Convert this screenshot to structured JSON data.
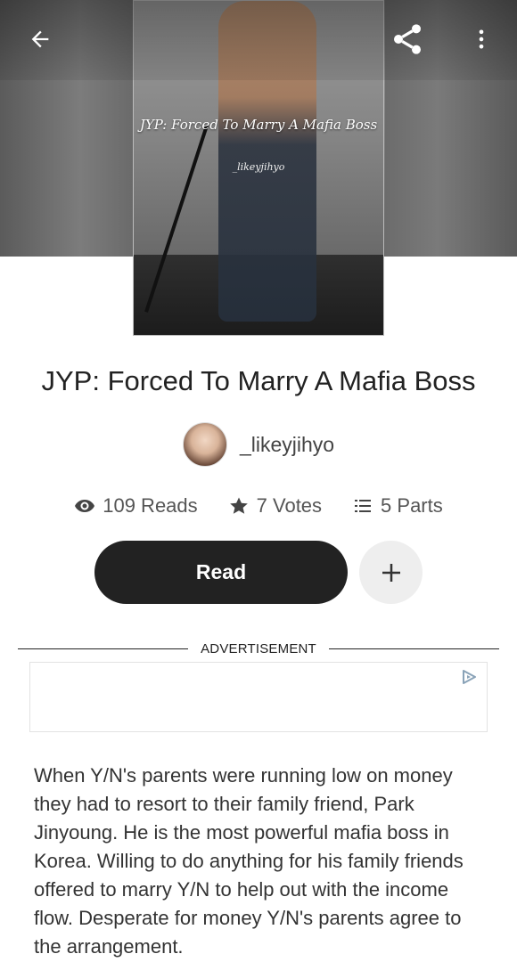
{
  "header": {
    "back_icon": "arrow-left-icon",
    "share_icon": "share-icon",
    "more_icon": "more-vertical-icon"
  },
  "cover": {
    "title": "JYP: Forced To Marry A Mafia Boss",
    "author_signature": "_likeyjihyo"
  },
  "story": {
    "title": "JYP: Forced To Marry A Mafia Boss",
    "author": "_likeyjihyo"
  },
  "stats": {
    "reads": "109 Reads",
    "votes": "7 Votes",
    "parts": "5 Parts"
  },
  "actions": {
    "read_label": "Read",
    "add_icon": "plus-icon"
  },
  "ad": {
    "label": "ADVERTISEMENT",
    "choices_icon": "ad-choices-icon"
  },
  "description": "When Y/N's parents were running low on money they had to resort to their family friend, Park Jinyoung. He is the most powerful mafia boss in Korea. Willing to do anything for his family friends offered to marry Y/N to help out with the income flow. Desperate for money Y/N's parents agree to the arrangement.",
  "colors": {
    "primary_button": "#222222",
    "secondary_button": "#eeeeee",
    "text": "#222222",
    "muted": "#555555"
  }
}
